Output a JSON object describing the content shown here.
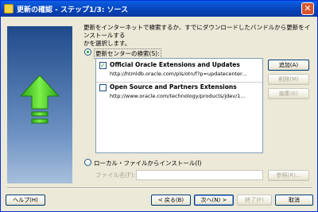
{
  "window": {
    "title": "更新の確認 - ステップ1/3: ソース",
    "close_label": "✕"
  },
  "intro_text": "更新をインターネットで検索するか、すでにダウンロードしたバンドルから更新をインストールする\nかを選択します。",
  "search_option": {
    "label": "更新センターの検索(S):",
    "selected": true
  },
  "update_centers": [
    {
      "checked": true,
      "title": "Official Oracle Extensions and Updates",
      "url": "http://htmldb.oracle.com/pls/otn/f?p=updatecenter..."
    },
    {
      "checked": false,
      "title": "Open Source and Partners Extensions",
      "url": "http://www.oracle.com/technology/products/jdev/1..."
    }
  ],
  "side_buttons": {
    "add": "追加(A)",
    "delete": "削除(M)",
    "edit": "編集(E)"
  },
  "local_option": {
    "label": "ローカル・ファイルからインストール(I)",
    "selected": false
  },
  "file_name": {
    "label": "ファイル名(F):",
    "value": "",
    "browse": "参照(R)..."
  },
  "footer": {
    "help": "ヘルプ(H)",
    "back": "< 戻る(B)",
    "next": "次へ(N) >",
    "finish": "終了(F)",
    "cancel": "取消"
  },
  "colors": {
    "titlebar": "#0842b6",
    "arrow": "#3fcf1f",
    "panel": "#1f4a8a"
  },
  "icons": {
    "arrow": "green-up-arrow-icon",
    "window": "update-app-icon"
  }
}
